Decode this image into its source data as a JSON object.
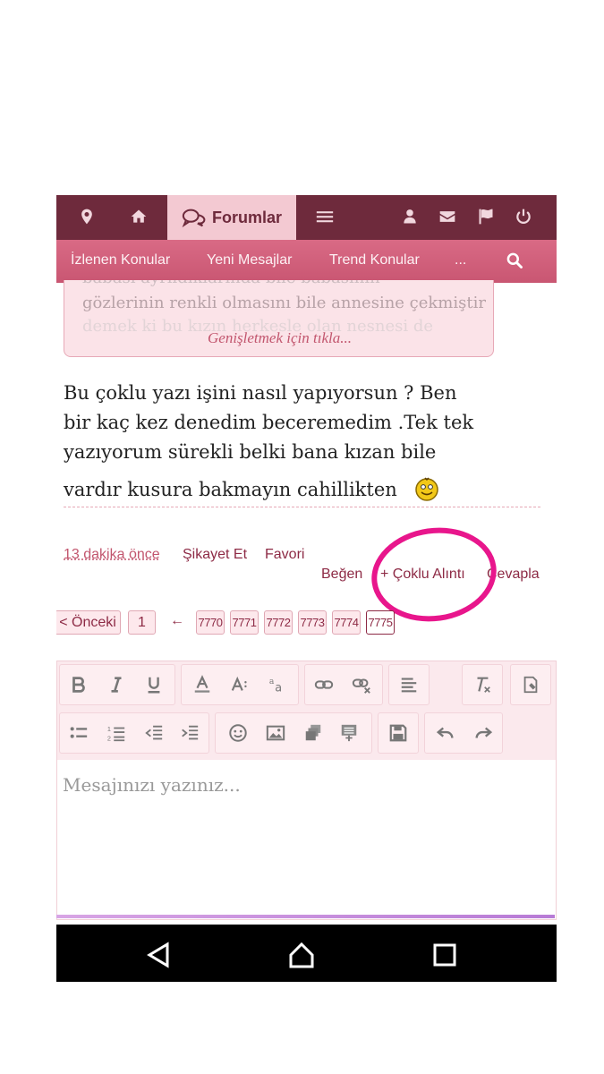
{
  "topnav": {
    "icons": [
      "location-icon",
      "home-icon",
      "menu-icon",
      "user-icon",
      "mail-icon",
      "flag-icon",
      "power-icon"
    ],
    "forum_tab_label": "Forumlar"
  },
  "subnav": {
    "links": [
      "İzlenen Konular",
      "Yeni Mesajlar",
      "Trend Konular",
      "..."
    ]
  },
  "quote": {
    "line_partial_top": "babasi ayrıldıklarında bile babasının",
    "line_full": "gözlerinin renkli olmasını bile annesine çekmiştir",
    "line_partial_bottom": "demek ki bu kızın herkesle olan nesnesi de",
    "expand_label": "Genişletmek için tıkla..."
  },
  "message": {
    "line1": "Bu çoklu yazı işini nasıl yapıyorsun ? Ben",
    "line2": "bir kaç kez denedim beceremedim .Tek tek",
    "line3": "yazıyorum sürekli belki bana kızan bile",
    "line4": "vardır kusura bakmayın cahillikten"
  },
  "meta": {
    "time": "13 dakika önce",
    "report": "Şikayet Et",
    "favorite": "Favori",
    "like": "Beğen",
    "multi_quote": "+ Çoklu Alıntı",
    "reply": "Cevapla"
  },
  "pagination": {
    "prev": "< Önceki",
    "first": "1",
    "arrow": "←",
    "pages": [
      "7770",
      "7771",
      "7772",
      "7773",
      "7774",
      "7775"
    ]
  },
  "editor": {
    "placeholder": "Mesajınızı yazınız..."
  },
  "colors": {
    "nav_dark": "#6e2a3c",
    "nav_pink": "#d96a85",
    "accent_text": "#8d2a45",
    "highlight_circle": "#e8168c"
  }
}
